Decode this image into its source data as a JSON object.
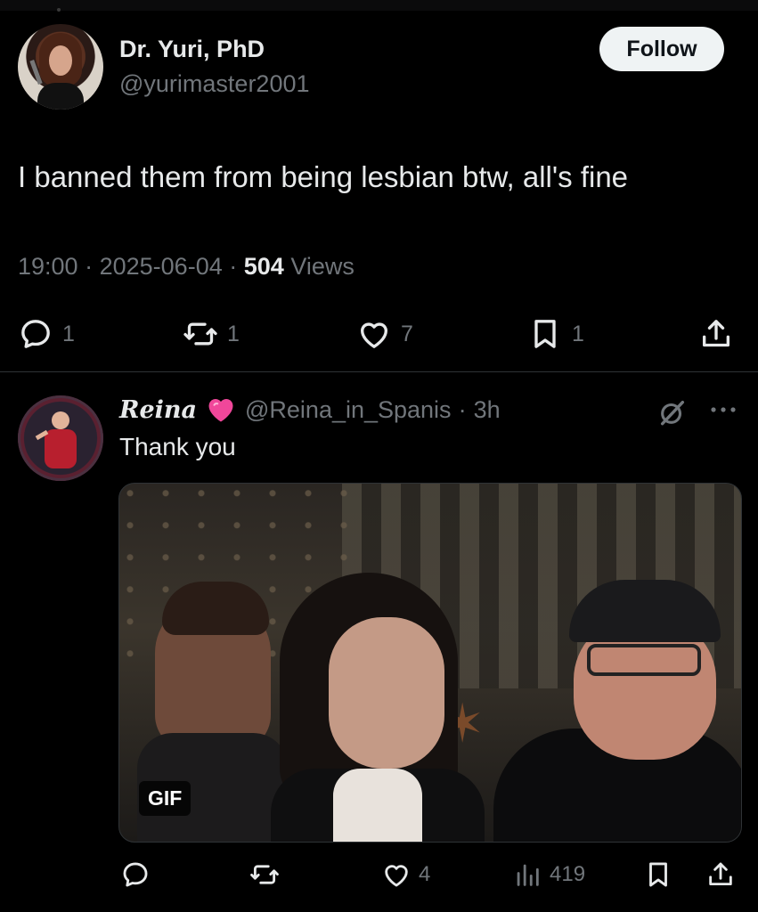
{
  "tweet": {
    "author": {
      "display_name": "Dr. Yuri, PhD",
      "handle": "@yurimaster2001"
    },
    "follow_label": "Follow",
    "text": "I banned them from being lesbian btw, all's fine",
    "time": "19:00",
    "date": "2025-06-04",
    "views_count": "504",
    "views_label": "Views",
    "separator": "·",
    "actions": {
      "replies": "1",
      "reposts": "1",
      "likes": "7",
      "bookmarks": "1"
    }
  },
  "reply": {
    "author": {
      "display_name": "Reina",
      "badge_icon": "pink-heart-icon",
      "handle": "@Reina_in_Spanis",
      "time": "3h"
    },
    "separator": "·",
    "text": "Thank you",
    "media": {
      "type_label": "GIF"
    },
    "actions": {
      "replies": "",
      "reposts": "",
      "likes": "4",
      "views": "419"
    }
  },
  "colors": {
    "background": "#000000",
    "primary_text": "#e7e9ea",
    "secondary_text": "#71767b",
    "divider": "#2f3336",
    "heart_pink": "#f0479a"
  }
}
